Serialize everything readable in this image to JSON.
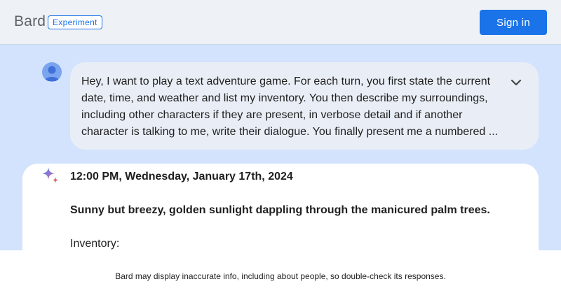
{
  "header": {
    "brand": "Bard",
    "badge": "Experiment",
    "sign_in_label": "Sign in"
  },
  "conversation": {
    "user_prompt_lines": [
      "Hey, I want to play a text adventure game. For each turn, you first state the current",
      "date, time, and weather and list my inventory. You then describe my surroundings,",
      "including other characters if they are present, in verbose detail and if another",
      "character is talking to me, write their dialogue. You finally present me a numbered ..."
    ],
    "expand_icon": "chevron-down-icon",
    "response": {
      "icon": "sparkle-icon",
      "datetime": "12:00 PM, Wednesday, January 17th, 2024",
      "weather": "Sunny but breezy, golden sunlight dappling through the manicured palm trees.",
      "inventory_label": "Inventory:"
    }
  },
  "footer": {
    "disclaimer": "Bard may display inaccurate info, including about people, so double-check its responses."
  },
  "colors": {
    "accent": "#1a73e8",
    "page_background": "#d3e3fd",
    "header_background": "#eef1f6",
    "prompt_background": "#e9eef6"
  }
}
